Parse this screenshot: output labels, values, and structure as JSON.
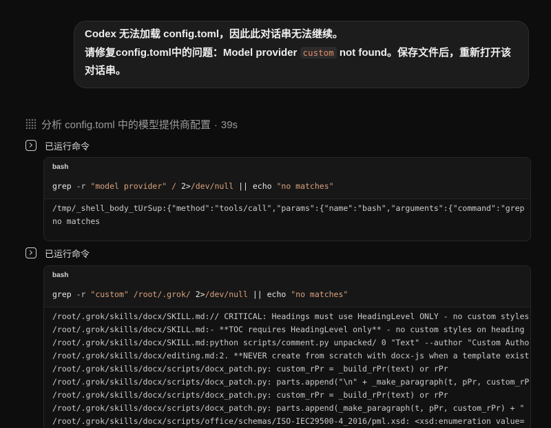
{
  "theme": {
    "page_bg": "#0d0d0d",
    "bubble_bg": "#1c1c1c",
    "bubble_border": "#2d2d2d",
    "text_primary": "#efefef",
    "text_muted": "#9a9a9a",
    "inline_code_bg": "#2b2b2b",
    "inline_code_fg": "#e48a6b",
    "block_header_bg": "#171717",
    "block_body_bg": "#121212",
    "block_border": "#262626",
    "output_fg": "#cbcbcb"
  },
  "user_message": {
    "paragraph1": "Codex 无法加载 config.toml，因此此对话串无法继续。",
    "paragraph2_before": "请修复config.toml中的问题：Model provider ",
    "paragraph2_code": "custom",
    "paragraph2_after": " not found。保存文件后，重新打开该对话串。"
  },
  "analysis": {
    "icon": "dot-grid-icon",
    "title": "分析 config.toml 中的模型提供商配置",
    "separator": "·",
    "duration": "39s"
  },
  "runs": [
    {
      "icon": "terminal-icon",
      "label": "已运行命令",
      "language": "bash",
      "command": [
        {
          "text": "grep",
          "color": "#e8e8e8"
        },
        {
          "text": " -r",
          "color": "#c6c6c6"
        },
        {
          "text": " \"model provider\"",
          "color": "#d9a27e"
        },
        {
          "text": " /",
          "color": "#d9a27e"
        },
        {
          "text": " 2>",
          "color": "#e8e8e8"
        },
        {
          "text": "/dev/null",
          "color": "#d9a27e"
        },
        {
          "text": " ||",
          "color": "#e8e8e8"
        },
        {
          "text": " echo",
          "color": "#e8e8e8"
        },
        {
          "text": " \"no matches\"",
          "color": "#d9a27e"
        }
      ],
      "output": [
        "/tmp/_shell_body_tUrSup:{\"method\":\"tools/call\",\"params\":{\"name\":\"bash\",\"arguments\":{\"command\":\"grep -",
        "no matches"
      ]
    },
    {
      "icon": "terminal-icon",
      "label": "已运行命令",
      "language": "bash",
      "command": [
        {
          "text": "grep",
          "color": "#e8e8e8"
        },
        {
          "text": " -r",
          "color": "#c6c6c6"
        },
        {
          "text": " \"custom\"",
          "color": "#d9a27e"
        },
        {
          "text": " /root/.grok/",
          "color": "#d9a27e"
        },
        {
          "text": " 2>",
          "color": "#e8e8e8"
        },
        {
          "text": "/dev/null",
          "color": "#d9a27e"
        },
        {
          "text": " ||",
          "color": "#e8e8e8"
        },
        {
          "text": " echo",
          "color": "#e8e8e8"
        },
        {
          "text": " \"no matches\"",
          "color": "#d9a27e"
        }
      ],
      "output": [
        "/root/.grok/skills/docx/SKILL.md:// CRITICAL: Headings must use HeadingLevel ONLY - no custom styles",
        "/root/.grok/skills/docx/SKILL.md:- **TOC requires HeadingLevel only** - no custom styles on heading",
        "/root/.grok/skills/docx/SKILL.md:python scripts/comment.py unpacked/ 0 \"Text\" --author \"Custom Autho",
        "/root/.grok/skills/docx/editing.md:2. **NEVER create from scratch with docx-js when a template exist",
        "/root/.grok/skills/docx/scripts/docx_patch.py: custom_rPr = _build_rPr(text) or rPr",
        "/root/.grok/skills/docx/scripts/docx_patch.py: parts.append(\"\\n\" + _make_paragraph(t, pPr, custom_rP",
        "/root/.grok/skills/docx/scripts/docx_patch.py: custom_rPr = _build_rPr(text) or rPr",
        "/root/.grok/skills/docx/scripts/docx_patch.py: parts.append(_make_paragraph(t, pPr, custom_rPr) + \"",
        "/root/.grok/skills/docx/scripts/office/schemas/ISO-IEC29500-4_2016/pml.xsd: <xsd:enumeration value="
      ]
    }
  ]
}
